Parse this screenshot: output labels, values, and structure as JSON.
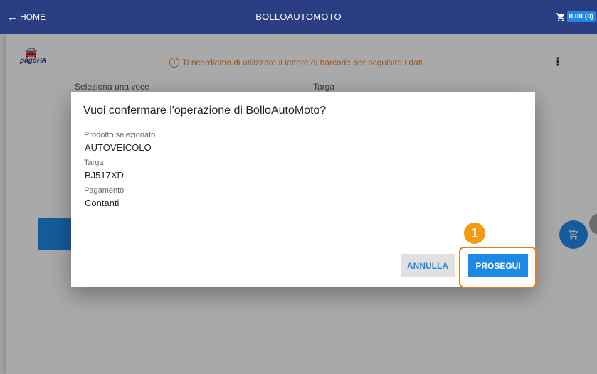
{
  "topbar": {
    "home_label": "HOME",
    "title": "BOLLOAUTOMOTO",
    "cart_total": "0,00 (0)"
  },
  "logo": {
    "text": "pagoPA"
  },
  "notice": {
    "text": "Ti ricordiamo di utilizzare il lettore di barcode per acquisire i dati"
  },
  "form": {
    "select_label": "Seleziona una voce",
    "plate_label": "Targa"
  },
  "dialog": {
    "title": "Vuoi confermare l'operazione di BolloAutoMoto?",
    "fields": [
      {
        "label": "Prodotto selezionato",
        "value": "AUTOVEICOLO"
      },
      {
        "label": "Targa",
        "value": "BJ517XD"
      },
      {
        "label": "Pagamento",
        "value": "Contanti"
      }
    ],
    "cancel_label": "ANNULLA",
    "confirm_label": "PROSEGUI"
  },
  "annotation": {
    "step_number": "1"
  },
  "colors": {
    "topbar": "#2c3e82",
    "accent": "#1e88e5",
    "highlight": "#e67e22",
    "badge": "#f39c12"
  }
}
